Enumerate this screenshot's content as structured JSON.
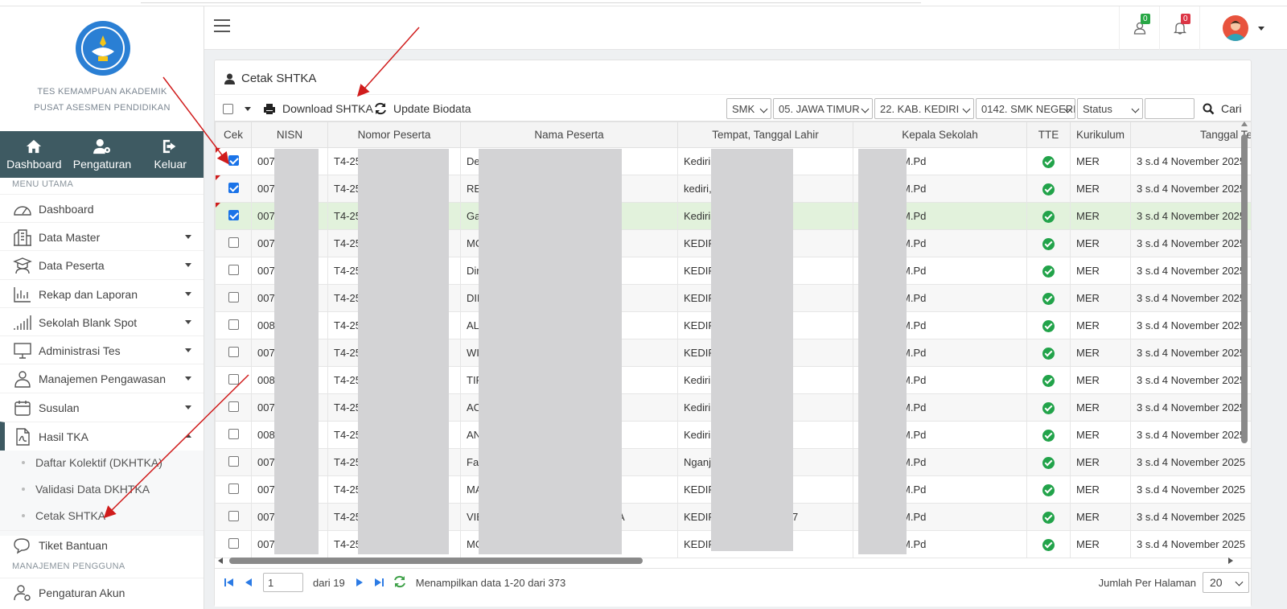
{
  "sidebar": {
    "subtitle1": "TES KEMAMPUAN AKADEMIK",
    "subtitle2": "PUSAT ASESMEN PENDIDIKAN",
    "quicknav": [
      {
        "label": "Dashboard",
        "icon": "home-icon"
      },
      {
        "label": "Pengaturan",
        "icon": "users-cog-icon"
      },
      {
        "label": "Keluar",
        "icon": "sign-out-icon"
      }
    ],
    "section_main": "MENU UTAMA",
    "items": [
      {
        "label": "Dashboard",
        "icon": "tachometer-icon",
        "has_caret": false
      },
      {
        "label": "Data Master",
        "icon": "building-icon",
        "has_caret": true
      },
      {
        "label": "Data Peserta",
        "icon": "graduate-icon",
        "has_caret": true
      },
      {
        "label": "Rekap dan Laporan",
        "icon": "bar-chart-icon",
        "has_caret": true
      },
      {
        "label": "Sekolah Blank Spot",
        "icon": "signal-icon",
        "has_caret": true
      },
      {
        "label": "Administrasi Tes",
        "icon": "monitor-icon",
        "has_caret": true
      },
      {
        "label": "Manajemen Pengawasan",
        "icon": "supervisor-icon",
        "has_caret": true
      },
      {
        "label": "Susulan",
        "icon": "calendar-icon",
        "has_caret": true
      },
      {
        "label": "Hasil TKA",
        "icon": "pdf-icon",
        "has_caret": true
      }
    ],
    "subitems": [
      "Daftar Kolektif (DKHTKA)",
      "Validasi Data DKHTKA",
      "Cetak SHTKA"
    ],
    "tiket": "Tiket Bantuan",
    "section_user": "MANAJEMEN PENGGUNA",
    "akun": "Pengaturan Akun"
  },
  "header": {
    "badge_user": "0",
    "badge_bell": "0"
  },
  "card": {
    "title": "Cetak SHTKA",
    "download_label": "Download SHTKA",
    "update_label": "Update Biodata",
    "filters": [
      "SMK",
      "05. JAWA TIMUR",
      "22. KAB. KEDIRI",
      "0142. SMK NEGERI",
      "Status"
    ],
    "search_label": "Cari"
  },
  "table": {
    "columns": [
      "Cek",
      "NISN",
      "Nomor Peserta",
      "Nama Peserta",
      "Tempat, Tanggal Lahir",
      "Kepala Sekolah",
      "TTE",
      "Kurikulum",
      "Tanggal Te"
    ],
    "rows": [
      {
        "checked": true,
        "nisn": "007",
        "nomor": "T4-25",
        "nama": "Der",
        "ttl": "Kediri,",
        "kepsek": "M.Pd",
        "kurikulum": "MER",
        "tanggal": "3 s.d 4 November 2025"
      },
      {
        "checked": true,
        "nisn": "007",
        "nomor": "T4-25",
        "nama": "REI",
        "ttl": "kediri,",
        "kepsek": "M.Pd",
        "kurikulum": "MER",
        "tanggal": "3 s.d 4 November 2025"
      },
      {
        "checked": true,
        "nisn": "007",
        "nomor": "T4-25",
        "nama": "Ga",
        "ttl": "Kediri,",
        "kepsek": "M.Pd",
        "kurikulum": "MER",
        "tanggal": "3 s.d 4 November 2025"
      },
      {
        "checked": false,
        "nisn": "007",
        "nomor": "T4-25",
        "nama": "MO",
        "ttl": "KEDIRI",
        "kepsek": "M.Pd",
        "kurikulum": "MER",
        "tanggal": "3 s.d 4 November 2025"
      },
      {
        "checked": false,
        "nisn": "007",
        "nomor": "T4-25",
        "nama": "Din",
        "ttl": "KEDIRI",
        "kepsek": "M.Pd",
        "kurikulum": "MER",
        "tanggal": "3 s.d 4 November 2025"
      },
      {
        "checked": false,
        "nisn": "007",
        "nomor": "T4-25",
        "nama": "DIN",
        "ttl": "KEDIRI",
        "kepsek": "M.Pd",
        "kurikulum": "MER",
        "tanggal": "3 s.d 4 November 2025"
      },
      {
        "checked": false,
        "nisn": "008",
        "nomor": "T4-25",
        "nama": "ALI",
        "ttl": "KEDIRI",
        "kepsek": "M.Pd",
        "kurikulum": "MER",
        "tanggal": "3 s.d 4 November 2025"
      },
      {
        "checked": false,
        "nisn": "007",
        "nomor": "T4-25",
        "nama": "WII",
        "ttl": "KEDIRI",
        "kepsek": "M.Pd",
        "kurikulum": "MER",
        "tanggal": "3 s.d 4 November 2025"
      },
      {
        "checked": false,
        "nisn": "008",
        "nomor": "T4-25",
        "nama": "TIF",
        "ttl": "Kediri,",
        "kepsek": "M.Pd",
        "kurikulum": "MER",
        "tanggal": "3 s.d 4 November 2025"
      },
      {
        "checked": false,
        "nisn": "007",
        "nomor": "T4-25",
        "nama": "AC",
        "ttl": "Kediri,",
        "kepsek": "M.Pd",
        "kurikulum": "MER",
        "tanggal": "3 s.d 4 November 2025"
      },
      {
        "checked": false,
        "nisn": "008",
        "nomor": "T4-25",
        "nama": "AN",
        "ttl": "Kediri,",
        "kepsek": "M.Pd",
        "kurikulum": "MER",
        "tanggal": "3 s.d 4 November 2025"
      },
      {
        "checked": false,
        "nisn": "007",
        "nomor": "T4-25",
        "nama": "Far",
        "ttl": "Nganju",
        "kepsek": "M.Pd",
        "kurikulum": "MER",
        "tanggal": "3 s.d 4 November 2025"
      },
      {
        "checked": false,
        "nisn": "007",
        "nomor": "T4-25",
        "nama": "MA",
        "ttl": "KEDIRI",
        "kepsek": "M.Pd",
        "kurikulum": "MER",
        "tanggal": "3 s.d 4 November 2025"
      },
      {
        "checked": false,
        "nisn": "007",
        "nomor": "T4-25",
        "nama": "VIE",
        "nama_tail": "A",
        "ttl": "KEDIRI",
        "ttl_tail": "7",
        "kepsek": "M.Pd",
        "kurikulum": "MER",
        "tanggal": "3 s.d 4 November 2025"
      },
      {
        "checked": false,
        "nisn": "007",
        "nomor": "T4-25",
        "nama": "MO",
        "ttl": "KEDIRI",
        "kepsek": "M.Pd",
        "kurikulum": "MER",
        "tanggal": "3 s.d 4 November 2025"
      }
    ]
  },
  "footer": {
    "page": "1",
    "dari": "dari 19",
    "info": "Menampilkan data 1-20 dari 373",
    "per_page_label": "Jumlah Per Halaman",
    "per_page": "20"
  },
  "colors": {
    "sidebar_dark": "#3e5a62",
    "highlight_row": "#e2f2dc",
    "tte_green": "#22a34a",
    "annotation_arrow": "#d01c1c"
  }
}
